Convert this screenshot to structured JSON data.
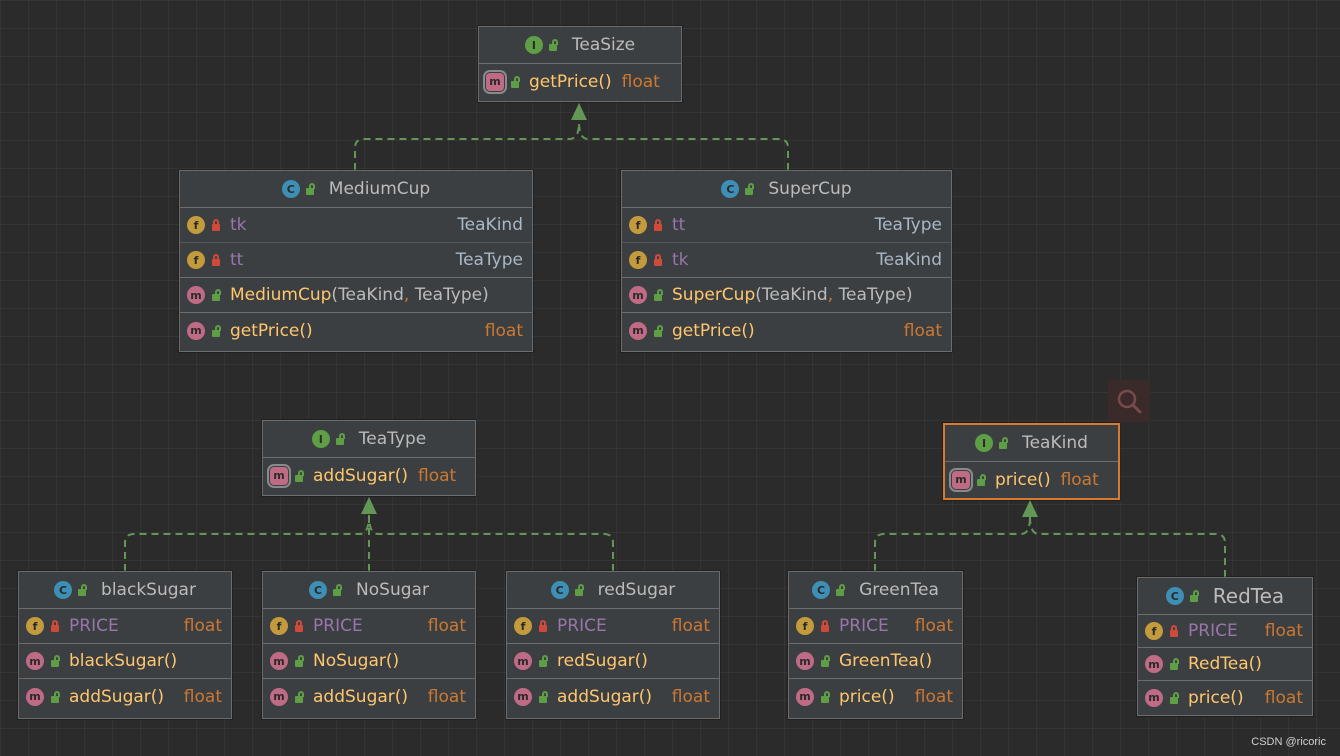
{
  "nodes": {
    "teasize": {
      "name": "TeaSize",
      "kind": "interface",
      "methods": [
        {
          "name": "getPrice()",
          "type": "float",
          "abstract": true
        }
      ]
    },
    "mediumcup": {
      "name": "MediumCup",
      "kind": "class",
      "fields": [
        {
          "name": "tk",
          "type": "TeaKind"
        },
        {
          "name": "tt",
          "type": "TeaType"
        }
      ],
      "constructor": {
        "name": "MediumCup",
        "arg1": "TeaKind",
        "comma": ",",
        "arg2": "TeaType"
      },
      "methods": [
        {
          "name": "getPrice()",
          "type": "float"
        }
      ]
    },
    "supercup": {
      "name": "SuperCup",
      "kind": "class",
      "fields": [
        {
          "name": "tt",
          "type": "TeaType"
        },
        {
          "name": "tk",
          "type": "TeaKind"
        }
      ],
      "constructor": {
        "name": "SuperCup",
        "arg1": "TeaKind",
        "comma": ",",
        "arg2": "TeaType"
      },
      "methods": [
        {
          "name": "getPrice()",
          "type": "float"
        }
      ]
    },
    "teatype": {
      "name": "TeaType",
      "kind": "interface",
      "methods": [
        {
          "name": "addSugar()",
          "type": "float",
          "abstract": true
        }
      ]
    },
    "teakind": {
      "name": "TeaKind",
      "kind": "interface",
      "selected": true,
      "methods": [
        {
          "name": "price()",
          "type": "float",
          "abstract": true
        }
      ]
    },
    "blacksugar": {
      "name": "blackSugar",
      "kind": "class",
      "field": {
        "name": "PRICE",
        "type": "float"
      },
      "constructor": "blackSugar()",
      "method": {
        "name": "addSugar()",
        "type": "float"
      }
    },
    "nosugar": {
      "name": "NoSugar",
      "kind": "class",
      "field": {
        "name": "PRICE",
        "type": "float"
      },
      "constructor": "NoSugar()",
      "method": {
        "name": "addSugar()",
        "type": "float"
      }
    },
    "redsugar": {
      "name": "redSugar",
      "kind": "class",
      "field": {
        "name": "PRICE",
        "type": "float"
      },
      "constructor": "redSugar()",
      "method": {
        "name": "addSugar()",
        "type": "float"
      }
    },
    "greentea": {
      "name": "GreenTea",
      "kind": "class",
      "field": {
        "name": "PRICE",
        "type": "float"
      },
      "constructor": "GreenTea()",
      "method": {
        "name": "price()",
        "type": "float"
      }
    },
    "redtea": {
      "name": "RedTea",
      "kind": "class",
      "field": {
        "name": "PRICE",
        "type": "float"
      },
      "constructor": "RedTea()",
      "method": {
        "name": "price()",
        "type": "float"
      }
    }
  },
  "relations": [
    {
      "from": "MediumCup",
      "to": "TeaSize",
      "type": "implements"
    },
    {
      "from": "SuperCup",
      "to": "TeaSize",
      "type": "implements"
    },
    {
      "from": "blackSugar",
      "to": "TeaType",
      "type": "implements"
    },
    {
      "from": "NoSugar",
      "to": "TeaType",
      "type": "implements"
    },
    {
      "from": "redSugar",
      "to": "TeaType",
      "type": "implements"
    },
    {
      "from": "GreenTea",
      "to": "TeaKind",
      "type": "implements"
    },
    {
      "from": "RedTea",
      "to": "TeaKind",
      "type": "implements"
    }
  ],
  "badges": {
    "interface": "I",
    "class": "C",
    "method": "m",
    "field": "f"
  },
  "colors": {
    "background": "#2b2b2b",
    "node": "#3c3f41",
    "edge": "#629755",
    "selected": "#d57a2e",
    "method": "#ffc66d",
    "field": "#9876aa",
    "keyword": "#cc7832"
  },
  "watermark": "CSDN @ricoric"
}
